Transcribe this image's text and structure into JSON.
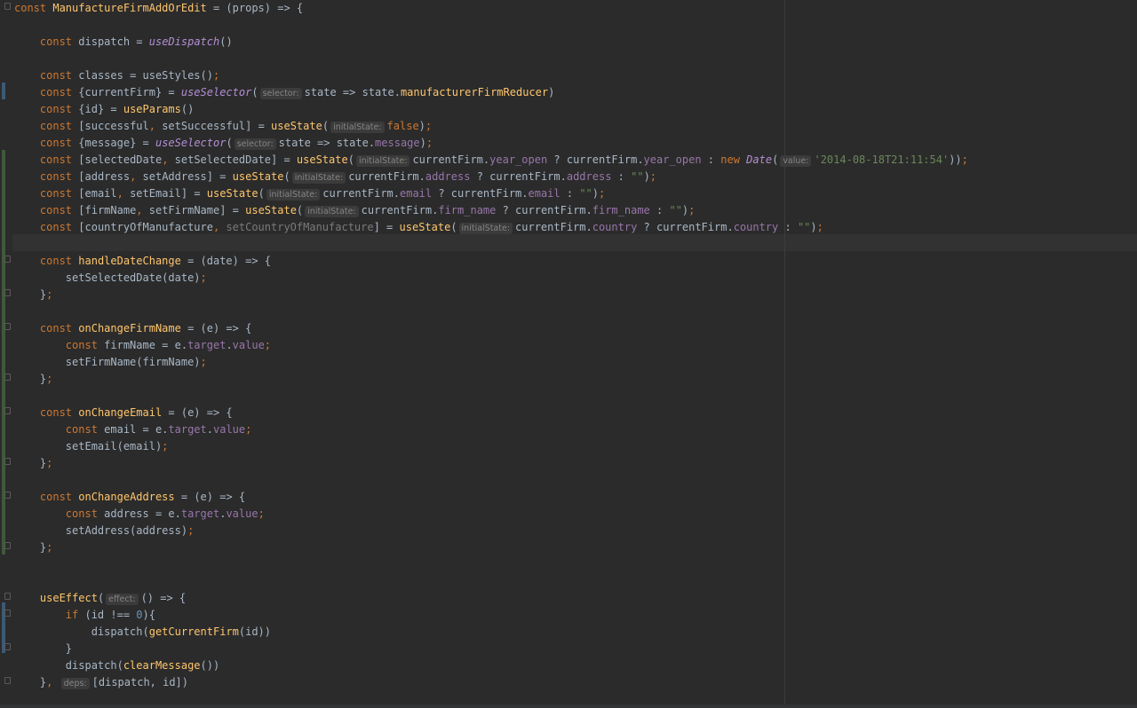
{
  "colors": {
    "background": "#2b2b2b",
    "keyword": "#cc7832",
    "text": "#a9b7c6",
    "function": "#ffc66d",
    "property": "#9876aa",
    "string": "#6a8759",
    "number": "#6897bb"
  },
  "code": {
    "lines": [
      [
        [
          "k",
          "const "
        ],
        [
          "f",
          "ManufactureFirmAddOrEdit"
        ],
        [
          "t",
          " = (props) => {"
        ]
      ],
      [],
      [
        [
          "t",
          "    "
        ],
        [
          "k",
          "const "
        ],
        [
          "t",
          "dispatch = "
        ],
        [
          "i",
          "useDispatch"
        ],
        [
          "t",
          "()"
        ]
      ],
      [],
      [
        [
          "t",
          "    "
        ],
        [
          "k",
          "const "
        ],
        [
          "t",
          "classes = useStyles()"
        ],
        [
          "k",
          ";"
        ]
      ],
      [
        [
          "t",
          "    "
        ],
        [
          "k",
          "const "
        ],
        [
          "t",
          "{currentFirm} = "
        ],
        [
          "i",
          "useSelector"
        ],
        [
          "t",
          "("
        ],
        [
          "h",
          "selector:"
        ],
        [
          "t",
          "state => state."
        ],
        [
          "f",
          "manufacturerFirmReducer"
        ],
        [
          "t",
          ")"
        ]
      ],
      [
        [
          "t",
          "    "
        ],
        [
          "k",
          "const "
        ],
        [
          "t",
          "{id} = "
        ],
        [
          "f",
          "useParams"
        ],
        [
          "t",
          "()"
        ]
      ],
      [
        [
          "t",
          "    "
        ],
        [
          "k",
          "const "
        ],
        [
          "t",
          "[successful"
        ],
        [
          "k",
          ", "
        ],
        [
          "t",
          "setSuccessful] = "
        ],
        [
          "f",
          "useState"
        ],
        [
          "t",
          "("
        ],
        [
          "h",
          "initialState:"
        ],
        [
          "k",
          "false"
        ],
        [
          "t",
          ")"
        ],
        [
          "k",
          ";"
        ]
      ],
      [
        [
          "t",
          "    "
        ],
        [
          "k",
          "const "
        ],
        [
          "t",
          "{message} = "
        ],
        [
          "i",
          "useSelector"
        ],
        [
          "t",
          "("
        ],
        [
          "h",
          "selector:"
        ],
        [
          "t",
          "state => state."
        ],
        [
          "p",
          "message"
        ],
        [
          "t",
          ")"
        ],
        [
          "k",
          ";"
        ]
      ],
      [
        [
          "t",
          "    "
        ],
        [
          "k",
          "const "
        ],
        [
          "t",
          "[selectedDate"
        ],
        [
          "k",
          ", "
        ],
        [
          "t",
          "setSelectedDate] = "
        ],
        [
          "f",
          "useState"
        ],
        [
          "t",
          "("
        ],
        [
          "h",
          "initialState:"
        ],
        [
          "t",
          "currentFirm."
        ],
        [
          "p",
          "year_open"
        ],
        [
          "t",
          " ? currentFirm."
        ],
        [
          "p",
          "year_open"
        ],
        [
          "t",
          " : "
        ],
        [
          "k",
          "new "
        ],
        [
          "i",
          "Date"
        ],
        [
          "t",
          "("
        ],
        [
          "h",
          "value:"
        ],
        [
          "s",
          "'2014-08-18T21:11:54'"
        ],
        [
          "t",
          "))"
        ],
        [
          "k",
          ";"
        ]
      ],
      [
        [
          "t",
          "    "
        ],
        [
          "k",
          "const "
        ],
        [
          "t",
          "[address"
        ],
        [
          "k",
          ", "
        ],
        [
          "t",
          "setAddress] = "
        ],
        [
          "f",
          "useState"
        ],
        [
          "t",
          "("
        ],
        [
          "h",
          "initialState:"
        ],
        [
          "t",
          "currentFirm."
        ],
        [
          "p",
          "address"
        ],
        [
          "t",
          " ? currentFirm."
        ],
        [
          "p",
          "address"
        ],
        [
          "t",
          " : "
        ],
        [
          "s",
          "\"\""
        ],
        [
          "t",
          ")"
        ],
        [
          "k",
          ";"
        ]
      ],
      [
        [
          "t",
          "    "
        ],
        [
          "k",
          "const "
        ],
        [
          "t",
          "[email"
        ],
        [
          "k",
          ", "
        ],
        [
          "t",
          "setEmail] = "
        ],
        [
          "f",
          "useState"
        ],
        [
          "t",
          "("
        ],
        [
          "h",
          "initialState:"
        ],
        [
          "t",
          "currentFirm."
        ],
        [
          "p",
          "email"
        ],
        [
          "t",
          " ? currentFirm."
        ],
        [
          "p",
          "email"
        ],
        [
          "t",
          " : "
        ],
        [
          "s",
          "\"\""
        ],
        [
          "t",
          ")"
        ],
        [
          "k",
          ";"
        ]
      ],
      [
        [
          "t",
          "    "
        ],
        [
          "k",
          "const "
        ],
        [
          "t",
          "[firmName"
        ],
        [
          "k",
          ", "
        ],
        [
          "t",
          "setFirmName] = "
        ],
        [
          "f",
          "useState"
        ],
        [
          "t",
          "("
        ],
        [
          "h",
          "initialState:"
        ],
        [
          "t",
          "currentFirm."
        ],
        [
          "p",
          "firm_name"
        ],
        [
          "t",
          " ? currentFirm."
        ],
        [
          "p",
          "firm_name"
        ],
        [
          "t",
          " : "
        ],
        [
          "s",
          "\"\""
        ],
        [
          "t",
          ")"
        ],
        [
          "k",
          ";"
        ]
      ],
      [
        [
          "t",
          "    "
        ],
        [
          "k",
          "const "
        ],
        [
          "t",
          "[countryOfManufacture"
        ],
        [
          "k",
          ", "
        ],
        [
          "g",
          "setCountryOfManufacture"
        ],
        [
          "t",
          "] = "
        ],
        [
          "f",
          "useState"
        ],
        [
          "t",
          "("
        ],
        [
          "h",
          "initialState:"
        ],
        [
          "t",
          "currentFirm."
        ],
        [
          "p",
          "country"
        ],
        [
          "t",
          " ? currentFirm."
        ],
        [
          "p",
          "country"
        ],
        [
          "t",
          " : "
        ],
        [
          "s",
          "\"\""
        ],
        [
          "t",
          ")"
        ],
        [
          "k",
          ";"
        ]
      ],
      [],
      [
        [
          "t",
          "    "
        ],
        [
          "k",
          "const "
        ],
        [
          "f",
          "handleDateChange"
        ],
        [
          "t",
          " = (date) => {"
        ]
      ],
      [
        [
          "t",
          "        setSelectedDate(date)"
        ],
        [
          "k",
          ";"
        ]
      ],
      [
        [
          "t",
          "    }"
        ],
        [
          "k",
          ";"
        ]
      ],
      [],
      [
        [
          "t",
          "    "
        ],
        [
          "k",
          "const "
        ],
        [
          "f",
          "onChangeFirmName"
        ],
        [
          "t",
          " = (e) => {"
        ]
      ],
      [
        [
          "t",
          "        "
        ],
        [
          "k",
          "const "
        ],
        [
          "t",
          "firmName = e."
        ],
        [
          "p",
          "target"
        ],
        [
          "t",
          "."
        ],
        [
          "p",
          "value"
        ],
        [
          "k",
          ";"
        ]
      ],
      [
        [
          "t",
          "        setFirmName(firmName)"
        ],
        [
          "k",
          ";"
        ]
      ],
      [
        [
          "t",
          "    }"
        ],
        [
          "k",
          ";"
        ]
      ],
      [],
      [
        [
          "t",
          "    "
        ],
        [
          "k",
          "const "
        ],
        [
          "f",
          "onChangeEmail"
        ],
        [
          "t",
          " = (e) => {"
        ]
      ],
      [
        [
          "t",
          "        "
        ],
        [
          "k",
          "const "
        ],
        [
          "t",
          "email = e."
        ],
        [
          "p",
          "target"
        ],
        [
          "t",
          "."
        ],
        [
          "p",
          "value"
        ],
        [
          "k",
          ";"
        ]
      ],
      [
        [
          "t",
          "        setEmail(email)"
        ],
        [
          "k",
          ";"
        ]
      ],
      [
        [
          "t",
          "    }"
        ],
        [
          "k",
          ";"
        ]
      ],
      [],
      [
        [
          "t",
          "    "
        ],
        [
          "k",
          "const "
        ],
        [
          "f",
          "onChangeAddress"
        ],
        [
          "t",
          " = (e) => {"
        ]
      ],
      [
        [
          "t",
          "        "
        ],
        [
          "k",
          "const "
        ],
        [
          "t",
          "address = e."
        ],
        [
          "p",
          "target"
        ],
        [
          "t",
          "."
        ],
        [
          "p",
          "value"
        ],
        [
          "k",
          ";"
        ]
      ],
      [
        [
          "t",
          "        setAddress(address)"
        ],
        [
          "k",
          ";"
        ]
      ],
      [
        [
          "t",
          "    }"
        ],
        [
          "k",
          ";"
        ]
      ],
      [],
      [],
      [
        [
          "t",
          "    "
        ],
        [
          "f",
          "useEffect"
        ],
        [
          "t",
          "("
        ],
        [
          "h",
          "effect:"
        ],
        [
          "t",
          "() => {"
        ]
      ],
      [
        [
          "t",
          "        "
        ],
        [
          "k",
          "if "
        ],
        [
          "t",
          "(id !== "
        ],
        [
          "n",
          "0"
        ],
        [
          "t",
          "){"
        ]
      ],
      [
        [
          "t",
          "            dispatch("
        ],
        [
          "f",
          "getCurrentFirm"
        ],
        [
          "t",
          "(id))"
        ]
      ],
      [
        [
          "t",
          "        }"
        ]
      ],
      [
        [
          "t",
          "        dispatch("
        ],
        [
          "f",
          "clearMessage"
        ],
        [
          "t",
          "())"
        ]
      ],
      [
        [
          "t",
          "    }"
        ],
        [
          "k",
          ", "
        ],
        [
          "h",
          "deps:"
        ],
        [
          "t",
          "[dispatch, id])"
        ]
      ]
    ]
  }
}
